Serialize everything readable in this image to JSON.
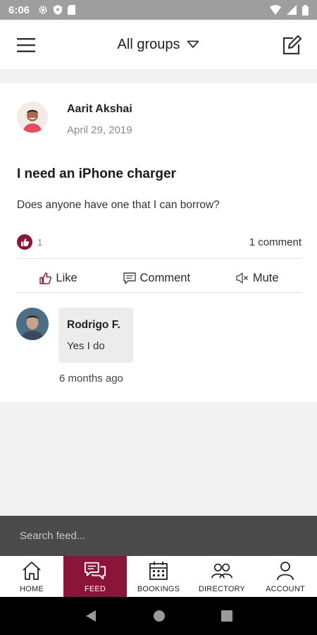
{
  "status_bar": {
    "time": "6:06"
  },
  "header": {
    "group_label": "All groups"
  },
  "post": {
    "author": "Aarit Akshai",
    "date": "April 29, 2019",
    "title": "I need an iPhone charger",
    "body": "Does anyone have one that I can borrow?",
    "like_count": "1",
    "comment_count": "1 comment",
    "actions": {
      "like": "Like",
      "comment": "Comment",
      "mute": "Mute"
    }
  },
  "comments": [
    {
      "author": "Rodrigo F.",
      "text": "Yes I do",
      "time": "6 months ago"
    }
  ],
  "search": {
    "placeholder": "Search feed..."
  },
  "nav": {
    "items": [
      {
        "label": "HOME",
        "icon": "home-icon"
      },
      {
        "label": "FEED",
        "icon": "chat-bubbles-icon",
        "active": true
      },
      {
        "label": "BOOKINGS",
        "icon": "calendar-icon"
      },
      {
        "label": "DIRECTORY",
        "icon": "people-icon"
      },
      {
        "label": "ACCOUNT",
        "icon": "person-icon"
      }
    ]
  },
  "colors": {
    "accent": "#8b1538",
    "status_bar": "#9e9e9e",
    "search_bar": "#4a4a4a"
  }
}
